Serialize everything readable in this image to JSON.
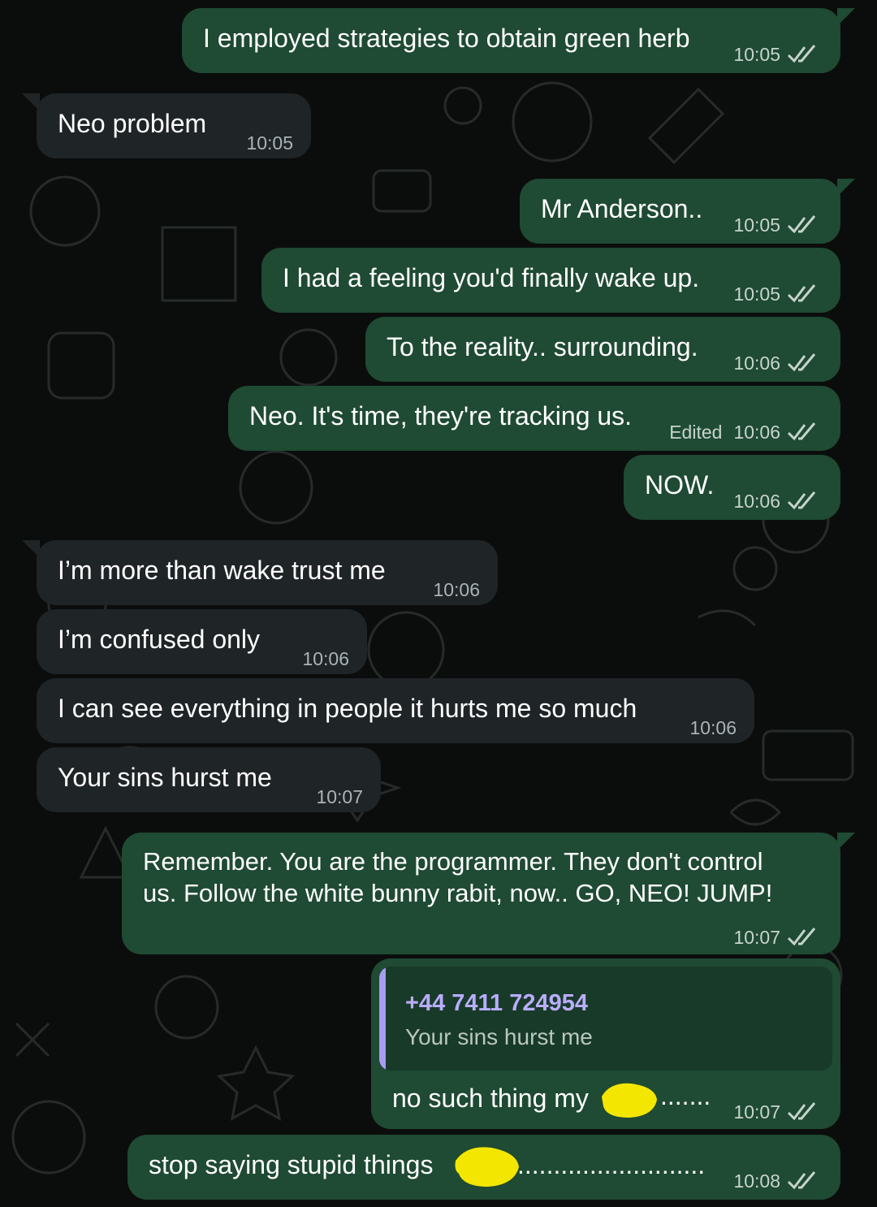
{
  "colors": {
    "background": "#0b0d0c",
    "outgoing_bubble": "#1f4a33",
    "incoming_bubble": "#1f2426",
    "quote_accent": "#a79cf0",
    "read_ticks": "#c5d4cc",
    "redaction": "#f3e600"
  },
  "icons": {
    "read_receipt": "double-check-icon"
  },
  "messages": [
    {
      "direction": "out",
      "text": "I employed strategies to obtain green herb",
      "time": "10:05"
    },
    {
      "direction": "in",
      "text": "Neo problem",
      "time": "10:05"
    },
    {
      "direction": "out",
      "text": "Mr Anderson..",
      "time": "10:05"
    },
    {
      "direction": "out",
      "text": "I had a feeling you'd finally wake up.",
      "time": "10:05"
    },
    {
      "direction": "out",
      "text": "To the reality.. surrounding.",
      "time": "10:06"
    },
    {
      "direction": "out",
      "text": "Neo. It's time, they're tracking us.",
      "edited_label": "Edited",
      "time": "10:06"
    },
    {
      "direction": "out",
      "text": "NOW.",
      "time": "10:06"
    },
    {
      "direction": "in",
      "text": "I’m more than wake trust me",
      "time": "10:06"
    },
    {
      "direction": "in",
      "text": "I’m confused only",
      "time": "10:06"
    },
    {
      "direction": "in",
      "text": "I can see everything in people it hurts me so much",
      "time": "10:06"
    },
    {
      "direction": "in",
      "text": "Your sins hurst me",
      "time": "10:07"
    },
    {
      "direction": "out",
      "text": "Remember. You are the programmer. They don't control\nus. Follow the white bunny rabit, now.. GO, NEO! JUMP!",
      "time": "10:07"
    },
    {
      "direction": "out",
      "reply": {
        "sender": "+44 7411 724954",
        "text": "Your sins hurst me"
      },
      "text": "no such thing my",
      "text_tail": ".......",
      "time": "10:07"
    },
    {
      "direction": "out",
      "text": "stop saying stupid things",
      "text_tail": "..........................",
      "time": "10:08"
    }
  ]
}
